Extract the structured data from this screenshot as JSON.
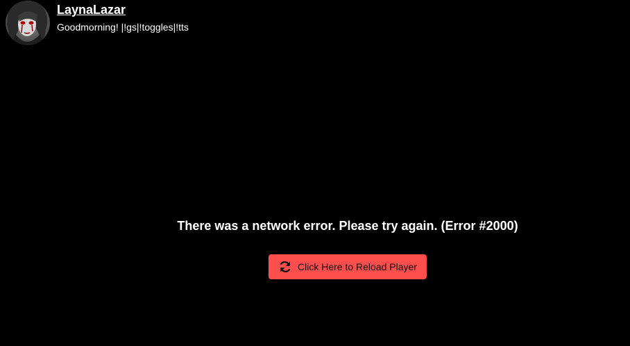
{
  "channel": {
    "name": "LaynaLazar",
    "title": "Goodmorning! |!gs|!toggles|!tts",
    "avatar_icon": "avatar-image"
  },
  "error": {
    "message": "There was a network error. Please try again. (Error #2000)"
  },
  "reload_button": {
    "label": "Click Here to Reload Player",
    "icon": "refresh-icon",
    "color": "#ff4f4d"
  }
}
